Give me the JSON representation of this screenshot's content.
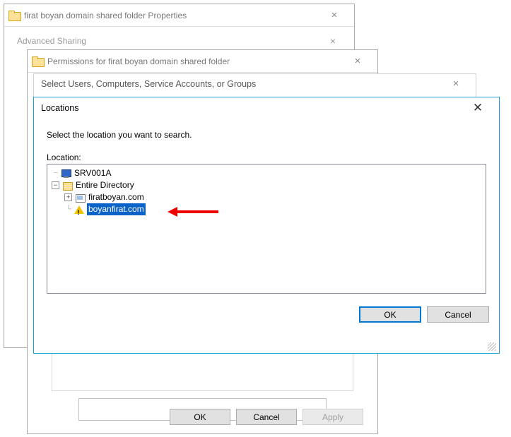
{
  "win1": {
    "title": "firat boyan domain shared folder Properties",
    "advanced_sharing": "Advanced Sharing"
  },
  "win2": {
    "title": "Permissions for firat boyan domain shared folder",
    "ok": "OK",
    "cancel": "Cancel",
    "apply": "Apply"
  },
  "win3": {
    "title": "Select Users, Computers, Service Accounts, or Groups"
  },
  "loc": {
    "title": "Locations",
    "instruction": "Select the location you want to search.",
    "label": "Location:",
    "tree": {
      "computer": "SRV001A",
      "entire_dir": "Entire Directory",
      "domain1": "firatboyan.com",
      "domain2": "boyanfirat.com"
    },
    "ok": "OK",
    "cancel": "Cancel"
  }
}
